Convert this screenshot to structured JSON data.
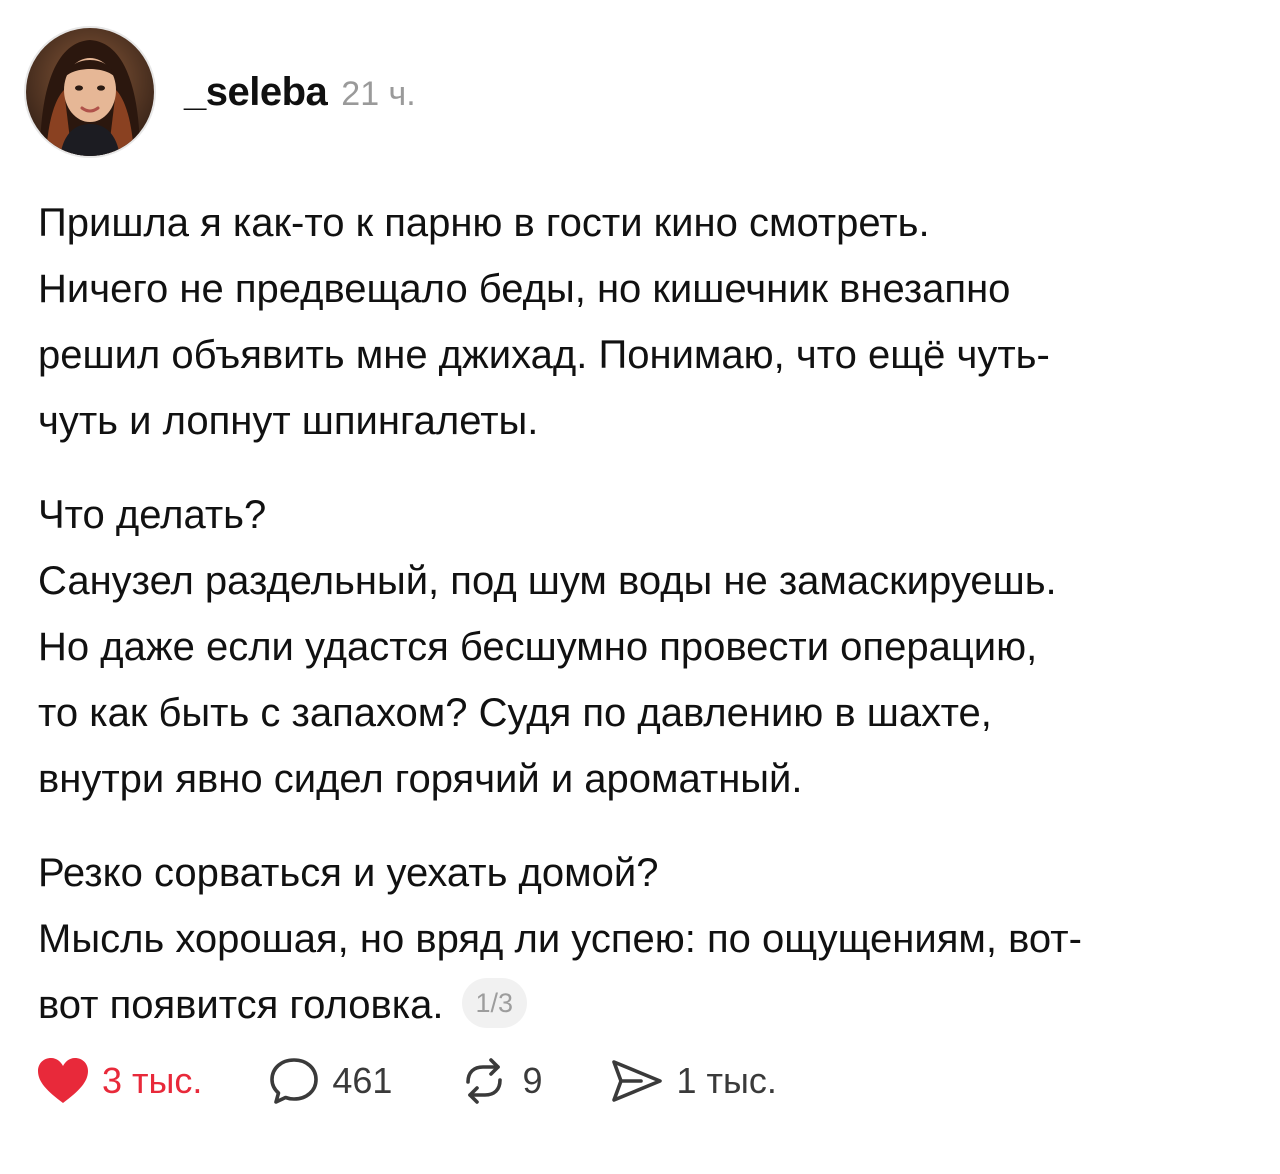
{
  "post": {
    "author": "_seleba",
    "time": "21 ч.",
    "avatar_icon": "avatar-photo",
    "paragraphs": [
      {
        "lines": [
          "Пришла я как-то к парню в гости кино смотреть.",
          "Ничего не предвещало беды, но кишечник внезапно",
          "решил объявить мне джихад. Понимаю, что ещё чуть-",
          "чуть и лопнут шпингалеты."
        ]
      },
      {
        "lines": [
          "Что делать?",
          "Санузел раздельный, под шум воды не замаскируешь.",
          "Но даже если удастся бесшумно провести операцию,",
          "то как быть с запахом? Судя по давлению в шахте,",
          "внутри явно сидел горячий и ароматный."
        ]
      },
      {
        "lines": [
          "Резко сорваться и уехать домой?",
          "Мысль хорошая, но вряд ли успею: по ощущениям, вот-",
          "вот появится головка."
        ]
      }
    ],
    "page_counter": "1/3"
  },
  "actions": {
    "like": {
      "count": "3 тыс.",
      "icon": "heart-filled-icon",
      "color": "#e8293a"
    },
    "comment": {
      "count": "461",
      "icon": "comment-icon"
    },
    "repost": {
      "count": "9",
      "icon": "repost-icon"
    },
    "share": {
      "count": "1 тыс.",
      "icon": "send-icon"
    }
  }
}
